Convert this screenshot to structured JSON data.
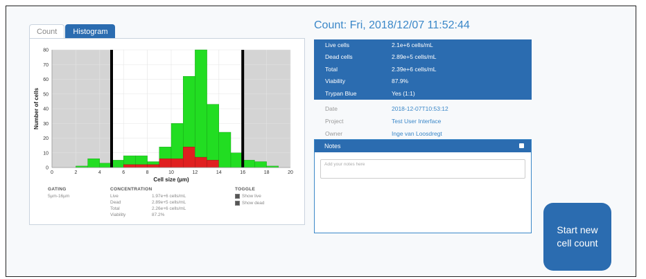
{
  "tabs": [
    {
      "label": "Count"
    },
    {
      "label": "Histogram"
    }
  ],
  "count_title": "Count: Fri, 2018/12/07 11:52:44",
  "results": [
    {
      "label": "Live cells",
      "value": "2.1e+6 cells/mL"
    },
    {
      "label": "Dead cells",
      "value": "2.89e+5 cells/mL"
    },
    {
      "label": "Total",
      "value": "2.39e+6 cells/mL"
    },
    {
      "label": "Viability",
      "value": "87.9%"
    },
    {
      "label": "Trypan Blue",
      "value": "Yes (1:1)"
    }
  ],
  "meta": [
    {
      "label": "Date",
      "value": "2018-12-07T10:53:12"
    },
    {
      "label": "Project",
      "value": "Test User Interface"
    },
    {
      "label": "Owner",
      "value": "Inge van Loosdregt"
    }
  ],
  "notes": {
    "title": "Notes",
    "placeholder": "Add your notes here"
  },
  "start_button": "Start new cell count",
  "stats": {
    "gating_title": "GATING",
    "gating_value": "5µm-16µm",
    "conc_title": "CONCENTRATION",
    "conc": [
      {
        "label": "Live",
        "value": "1.97e+6 cells/mL"
      },
      {
        "label": "Dead",
        "value": "2.89e+5 cells/mL"
      },
      {
        "label": "Total",
        "value": "2.26e+6 cells/mL"
      },
      {
        "label": "Viability",
        "value": "87.2%"
      }
    ],
    "toggle_title": "TOGGLE",
    "toggles": [
      {
        "label": "Show live"
      },
      {
        "label": "Show dead"
      }
    ]
  },
  "chart_data": {
    "type": "bar",
    "xlabel": "Cell size (µm)",
    "ylabel": "Number of cells",
    "xlim": [
      0,
      20
    ],
    "ylim": [
      0,
      80
    ],
    "xticks": [
      0,
      2,
      4,
      6,
      8,
      10,
      12,
      14,
      16,
      18,
      20
    ],
    "yticks": [
      0,
      10,
      20,
      30,
      40,
      50,
      60,
      70,
      80
    ],
    "bin_width": 1,
    "gate": [
      5,
      16
    ],
    "colors": {
      "live": "#22dd22",
      "dead": "#e02020",
      "gated_out": "#d4d4d4",
      "gate_line": "#000000"
    },
    "series": [
      {
        "name": "live",
        "x": [
          2,
          3,
          4,
          5,
          6,
          7,
          8,
          9,
          10,
          11,
          12,
          13,
          14,
          15,
          16,
          17,
          18
        ],
        "values": [
          1,
          6,
          3,
          5,
          6,
          6,
          2,
          8,
          24,
          48,
          73,
          38,
          24,
          10,
          5,
          4,
          1
        ]
      },
      {
        "name": "dead",
        "x": [
          2,
          3,
          4,
          5,
          6,
          7,
          8,
          9,
          10,
          11,
          12,
          13,
          14,
          15,
          16,
          17,
          18
        ],
        "values": [
          0,
          0,
          0,
          0,
          2,
          2,
          2,
          6,
          6,
          14,
          7,
          5,
          0,
          0,
          0,
          0,
          0
        ]
      }
    ]
  }
}
